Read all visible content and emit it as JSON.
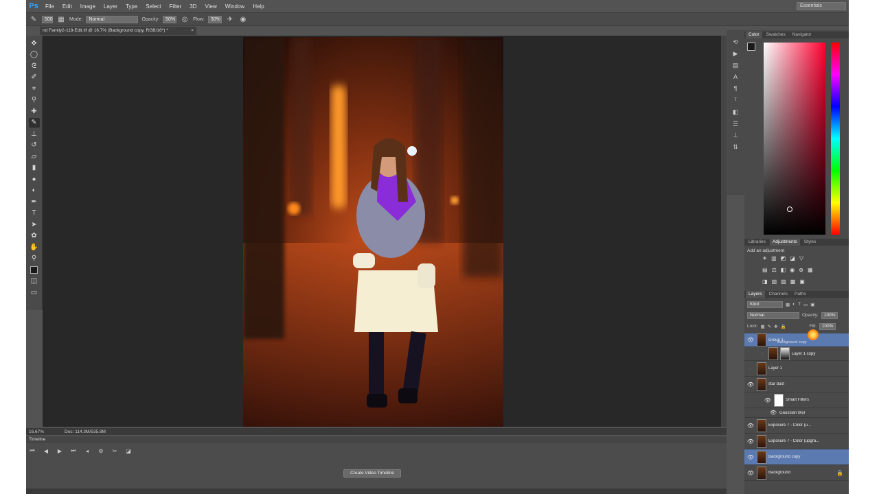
{
  "app": {
    "logo": "Ps",
    "menu": [
      "File",
      "Edit",
      "Image",
      "Layer",
      "Type",
      "Select",
      "Filter",
      "3D",
      "View",
      "Window",
      "Help"
    ],
    "workspace": "Essentials"
  },
  "options": {
    "brush_size": "500",
    "mode_label": "Mode:",
    "mode_value": "Normal",
    "opacity_label": "Opacity:",
    "opacity_value": "50%",
    "flow_label": "Flow:",
    "flow_value": "30%"
  },
  "document": {
    "tab_title": "nd Family2-118-Edit.tif @ 16.7% (Background copy, RGB/16*) *",
    "close": "×"
  },
  "status": {
    "zoom": "16.67%",
    "doc_size": "Doc: 114.3M/535.8M"
  },
  "timeline": {
    "label": "Timeline",
    "create_button": "Create Video Timeline"
  },
  "color_panel": {
    "tabs": [
      "Color",
      "Swatches",
      "Navigator"
    ],
    "active": 0
  },
  "adjustments_panel": {
    "tabs": [
      "Libraries",
      "Adjustments",
      "Styles"
    ],
    "active": 1,
    "title": "Add an adjustment"
  },
  "layers_panel": {
    "tabs": [
      "Layers",
      "Channels",
      "Paths"
    ],
    "active": 0,
    "filter_kind": "Kind",
    "blend_mode": "Normal",
    "opacity_label": "Opacity:",
    "opacity_value": "100%",
    "lock_label": "Lock:",
    "fill_label": "Fill:",
    "fill_value": "100%",
    "layers": [
      {
        "name": "Group 1",
        "sub": "Background copy",
        "visible": true,
        "selected": true,
        "thumb": "photo"
      },
      {
        "name": "Layer 1 copy",
        "visible": false,
        "selected": false,
        "thumb": "mask"
      },
      {
        "name": "Layer 1",
        "visible": false,
        "selected": false,
        "thumb": "photo"
      },
      {
        "name": "star dust",
        "visible": true,
        "selected": false,
        "thumb": "photo"
      },
      {
        "name": "Smart Filters",
        "visible": true,
        "selected": false,
        "thumb": "white"
      },
      {
        "name": "Gaussian Blur",
        "visible": true,
        "selected": false,
        "thumb": "none"
      },
      {
        "name": "Exposure 7 - Color (u...",
        "visible": true,
        "selected": false,
        "thumb": "photo"
      },
      {
        "name": "Exposure 7 - Color (upgra...",
        "visible": true,
        "selected": false,
        "thumb": "photo"
      },
      {
        "name": "Background copy",
        "visible": true,
        "selected": true,
        "thumb": "photo"
      },
      {
        "name": "Background",
        "visible": true,
        "selected": false,
        "thumb": "photo"
      }
    ]
  },
  "tools": [
    "move",
    "marquee",
    "lasso",
    "quick-select",
    "crop",
    "eyedropper",
    "healing",
    "brush",
    "clone",
    "history-brush",
    "eraser",
    "gradient",
    "blur",
    "dodge",
    "pen",
    "type",
    "path-select",
    "shape",
    "hand",
    "zoom"
  ],
  "colors": {
    "ui_bg": "#535353",
    "canvas_bg": "#282828",
    "selection": "#5a7ab0",
    "brand": "#31a8ff"
  }
}
